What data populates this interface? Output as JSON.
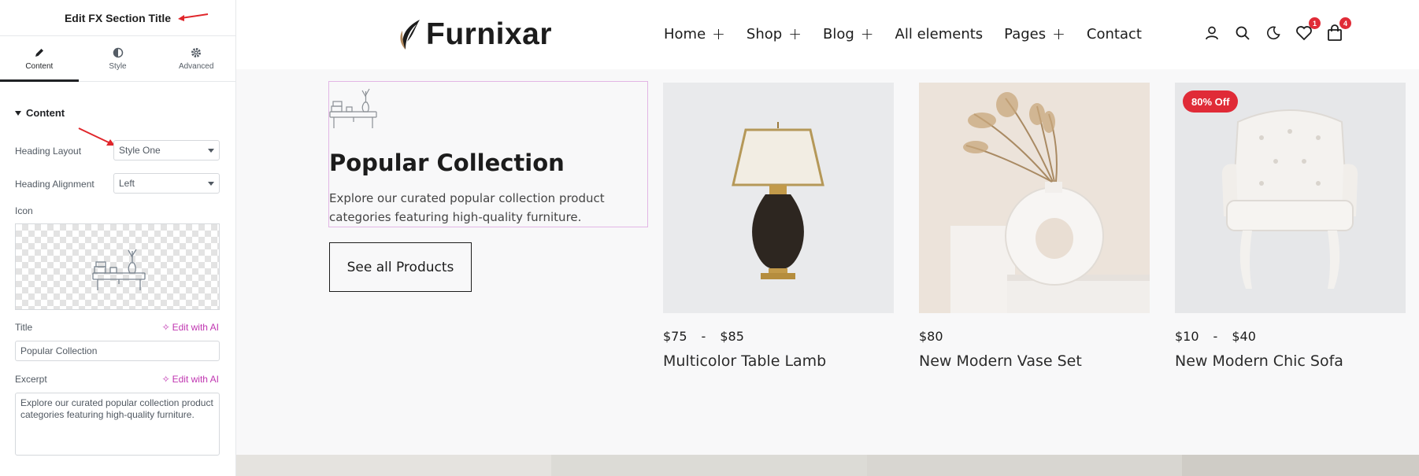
{
  "editor": {
    "title": "Edit FX Section Title",
    "tabs": [
      {
        "label": "Content",
        "icon": "pencil-icon"
      },
      {
        "label": "Style",
        "icon": "half-circle-icon"
      },
      {
        "label": "Advanced",
        "icon": "gear-icon"
      }
    ],
    "section_title": "Content",
    "heading_layout": {
      "label": "Heading Layout",
      "value": "Style One"
    },
    "heading_alignment": {
      "label": "Heading Alignment",
      "value": "Left"
    },
    "icon_label": "Icon",
    "title_field": {
      "label": "Title",
      "ai_label": "Edit with AI",
      "value": "Popular Collection"
    },
    "excerpt_field": {
      "label": "Excerpt",
      "ai_label": "Edit with AI",
      "value": "Explore our curated popular collection product categories featuring high-quality furniture."
    },
    "accent_color": "#c036b1"
  },
  "site": {
    "logo_text": "Furnixar",
    "nav": [
      {
        "label": "Home",
        "has_plus": true
      },
      {
        "label": "Shop",
        "has_plus": true
      },
      {
        "label": "Blog",
        "has_plus": true
      },
      {
        "label": "All elements",
        "has_plus": false
      },
      {
        "label": "Pages",
        "has_plus": true
      },
      {
        "label": "Contact",
        "has_plus": false
      }
    ],
    "plus_symbol": "+",
    "header_icons": [
      {
        "name": "user-icon"
      },
      {
        "name": "search-icon"
      },
      {
        "name": "moon-icon"
      },
      {
        "name": "heart-icon",
        "badge": "1"
      },
      {
        "name": "bag-icon",
        "badge": "4"
      }
    ],
    "section": {
      "title": "Popular Collection",
      "excerpt": "Explore our curated popular collection product categories featuring high-quality furniture.",
      "button": "See all Products"
    },
    "products": [
      {
        "price_min": "$75",
        "separator": "-",
        "price_max": "$85",
        "name": "Multicolor Table Lamb",
        "badge": ""
      },
      {
        "price_min": "$80",
        "separator": "",
        "price_max": "",
        "name": "New Modern Vase Set",
        "badge": ""
      },
      {
        "price_min": "$10",
        "separator": "-",
        "price_max": "$40",
        "name": "New Modern Chic Sofa",
        "badge": "80% Off"
      }
    ],
    "badge_color": "#e02b37"
  }
}
